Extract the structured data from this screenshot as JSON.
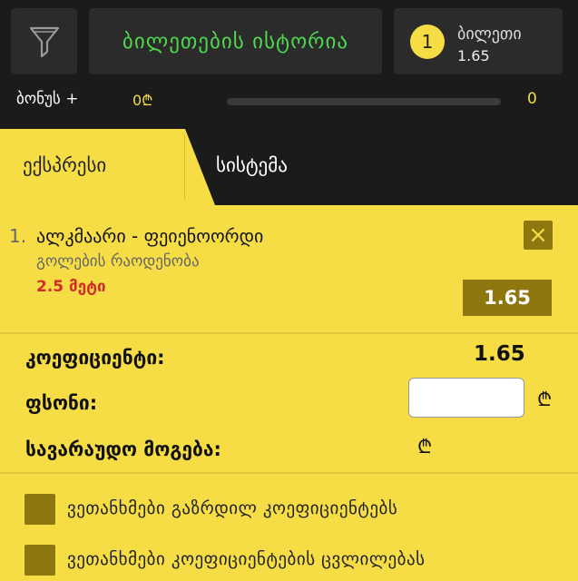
{
  "header": {
    "filter_icon": "funnel-icon",
    "history_label": "ბილეთების ისტორია",
    "history_color": "#4fd84f",
    "ticket_count": "1",
    "ticket_label": "ბილეთი",
    "ticket_odd": "1.65"
  },
  "bonus": {
    "label": "ბონუს +",
    "amount": "0₾",
    "progress": 0,
    "count": "0"
  },
  "tabs": {
    "express": "ექსპრესი",
    "system": "სისტემა"
  },
  "bet": {
    "index": "1.",
    "match": "ალკმაარი - ფეიენოორდი",
    "market": "გოლების რაოდენობა",
    "pick": "2.5 მეტი",
    "odd": "1.65",
    "close_icon": "close-icon"
  },
  "calc": {
    "coef_label": "კოეფიციენტი:",
    "coef_value": "1.65",
    "stake_label": "ფსონი:",
    "stake_value": "",
    "currency": "₾",
    "win_label": "სავარაუდო მოგება:"
  },
  "options": {
    "opt1": "ვეთანხმები გაზრდილ კოეფიციენტებს",
    "opt2": "ვეთანხმები კოეფიციენტების ცვლილებას"
  },
  "colors": {
    "accent": "#f7dd45",
    "dark": "#1b1b1b",
    "checkbox": "#8f7710",
    "pick_red": "#d22b2b"
  }
}
